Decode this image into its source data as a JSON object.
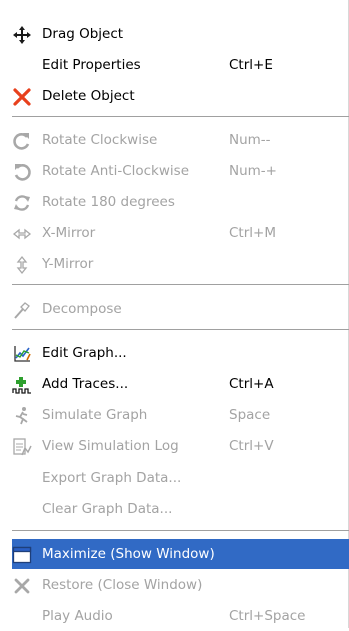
{
  "menu": {
    "items": [
      {
        "label": "Drag Object",
        "shortcut": "",
        "icon": "move-icon",
        "enabled": true
      },
      {
        "label": "Edit Properties",
        "shortcut": "Ctrl+E",
        "icon": "",
        "enabled": true
      },
      {
        "label": "Delete Object",
        "shortcut": "",
        "icon": "delete-icon",
        "enabled": true
      },
      {
        "label": "Rotate Clockwise",
        "shortcut": "Num--",
        "icon": "rotate-clockwise-icon",
        "enabled": false
      },
      {
        "label": "Rotate Anti-Clockwise",
        "shortcut": "Num-+",
        "icon": "rotate-anticlockwise-icon",
        "enabled": false
      },
      {
        "label": "Rotate 180 degrees",
        "shortcut": "",
        "icon": "rotate-180-icon",
        "enabled": false
      },
      {
        "label": "X-Mirror",
        "shortcut": "Ctrl+M",
        "icon": "x-mirror-icon",
        "enabled": false
      },
      {
        "label": "Y-Mirror",
        "shortcut": "",
        "icon": "y-mirror-icon",
        "enabled": false
      },
      {
        "label": "Decompose",
        "shortcut": "",
        "icon": "decompose-icon",
        "enabled": false
      },
      {
        "label": "Edit Graph...",
        "shortcut": "",
        "icon": "graph-icon",
        "enabled": true
      },
      {
        "label": "Add Traces...",
        "shortcut": "Ctrl+A",
        "icon": "add-traces-icon",
        "enabled": true
      },
      {
        "label": "Simulate Graph",
        "shortcut": "Space",
        "icon": "simulate-icon",
        "enabled": false
      },
      {
        "label": "View Simulation Log",
        "shortcut": "Ctrl+V",
        "icon": "simulation-log-icon",
        "enabled": false
      },
      {
        "label": "Export Graph Data...",
        "shortcut": "",
        "icon": "",
        "enabled": false
      },
      {
        "label": "Clear Graph Data...",
        "shortcut": "",
        "icon": "",
        "enabled": false
      },
      {
        "label": "Maximize (Show Window)",
        "shortcut": "",
        "icon": "window-icon",
        "enabled": true,
        "selected": true
      },
      {
        "label": "Restore (Close Window)",
        "shortcut": "",
        "icon": "close-icon",
        "enabled": false
      },
      {
        "label": "Play Audio",
        "shortcut": "Ctrl+Space",
        "icon": "",
        "enabled": false
      }
    ]
  },
  "colors": {
    "selection": "#316ac5",
    "disabled_text": "#a3a3a3",
    "delete_red": "#e8401c",
    "add_green": "#2ea02e"
  }
}
